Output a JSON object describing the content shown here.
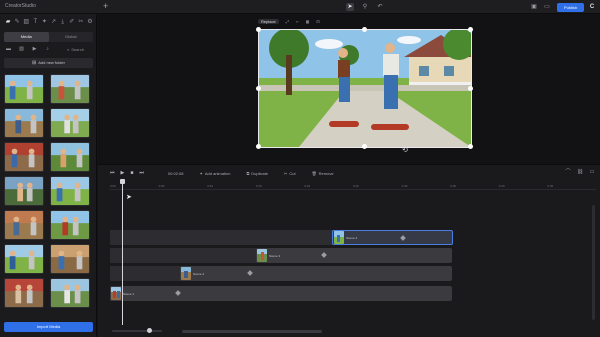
{
  "app": {
    "title": "CreatorStudio",
    "new_tab": "+"
  },
  "titlebar": {
    "icons": [
      "cursor-icon",
      "pin-icon",
      "undo-icon"
    ],
    "right_icons": [
      "layout-icon",
      "monitor-icon"
    ],
    "publish_label": "Publish"
  },
  "left_panel": {
    "tools": [
      "folder-icon",
      "brush-icon",
      "image-icon",
      "text-icon",
      "sparkle-icon",
      "arrow-icon",
      "download-icon",
      "pencil-icon",
      "cut-icon",
      "settings-icon"
    ],
    "tabs": [
      {
        "label": "Media",
        "active": true
      },
      {
        "label": "Global",
        "active": false
      }
    ],
    "search_label": "Search",
    "add_folder_label": "Add new folder",
    "import_label": "Import Media",
    "thumb_count": 14
  },
  "preview": {
    "toolbar": {
      "replace_label": "Replace",
      "icons": [
        "expand-icon",
        "code-icon",
        "grid-icon",
        "link-icon"
      ]
    }
  },
  "timeline": {
    "time": "00:02:08",
    "actions": [
      {
        "icon": "sparkle-icon",
        "label": "Add animation"
      },
      {
        "icon": "copy-icon",
        "label": "Duplicate"
      },
      {
        "icon": "scissors-icon",
        "label": "Cut"
      },
      {
        "icon": "trash-icon",
        "label": "Remove"
      }
    ],
    "ruler_ticks": [
      "0:00",
      "0:05",
      "0:10",
      "0:15",
      "0:20",
      "0:25",
      "0:30",
      "0:35",
      "0:40",
      "0:45"
    ],
    "clips": [
      {
        "label": "Scene 4"
      },
      {
        "label": "Scene 3"
      },
      {
        "label": "Scene 2"
      },
      {
        "label": "Scene 1"
      }
    ]
  },
  "colors": {
    "accent": "#2f6fe8",
    "background": "#141416",
    "panel": "#1b1b1e"
  }
}
